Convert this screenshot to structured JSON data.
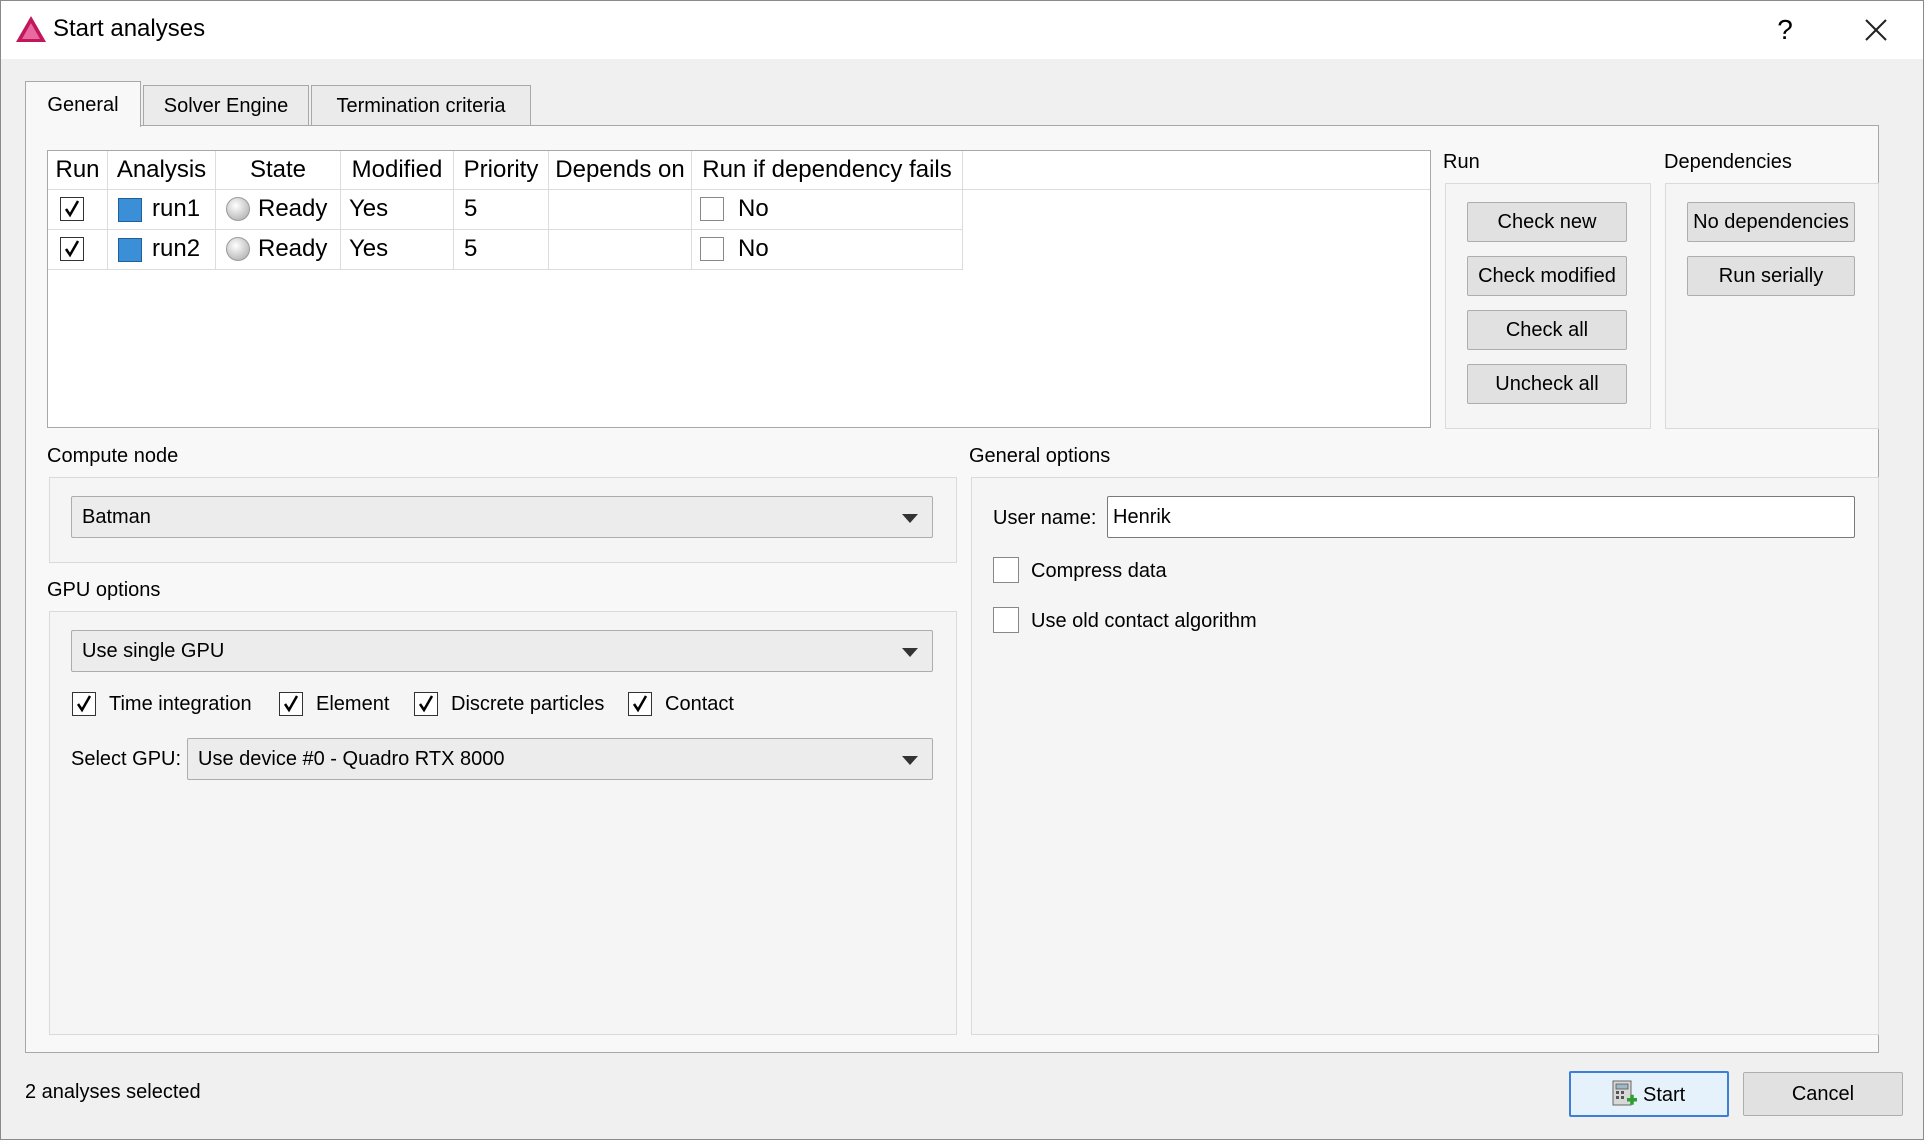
{
  "window": {
    "title": "Start analyses",
    "help_label": "?",
    "icon": "app-triangle-icon"
  },
  "tabs": [
    {
      "label": "General",
      "active": true
    },
    {
      "label": "Solver Engine",
      "active": false
    },
    {
      "label": "Termination criteria",
      "active": false
    }
  ],
  "analyses_table": {
    "columns": [
      "Run",
      "Analysis",
      "State",
      "Modified",
      "Priority",
      "Depends on",
      "Run if dependency fails"
    ],
    "rows": [
      {
        "run": true,
        "analysis": "run1",
        "state": "Ready",
        "modified": "Yes",
        "priority": "5",
        "depends_on": "",
        "run_if_fails": false,
        "run_if_fails_label": "No"
      },
      {
        "run": true,
        "analysis": "run2",
        "state": "Ready",
        "modified": "Yes",
        "priority": "5",
        "depends_on": "",
        "run_if_fails": false,
        "run_if_fails_label": "No"
      }
    ]
  },
  "run_group": {
    "label": "Run",
    "buttons": [
      "Check new",
      "Check modified",
      "Check all",
      "Uncheck all"
    ]
  },
  "dependencies_group": {
    "label": "Dependencies",
    "buttons": [
      "No dependencies",
      "Run serially"
    ]
  },
  "compute_node": {
    "label": "Compute node",
    "value": "Batman"
  },
  "gpu_options": {
    "label": "GPU options",
    "mode": "Use single GPU",
    "checks": [
      {
        "label": "Time integration",
        "checked": true
      },
      {
        "label": "Element",
        "checked": true
      },
      {
        "label": "Discrete particles",
        "checked": true
      },
      {
        "label": "Contact",
        "checked": true
      }
    ],
    "select_gpu_label": "Select GPU:",
    "select_gpu_value": "Use device #0 - Quadro RTX 8000"
  },
  "general_options": {
    "label": "General options",
    "user_name_label": "User name:",
    "user_name_value": "Henrik",
    "checks": [
      {
        "label": "Compress data",
        "checked": false
      },
      {
        "label": "Use old contact algorithm",
        "checked": false
      }
    ]
  },
  "footer": {
    "status": "2 analyses selected",
    "start_label": "Start",
    "cancel_label": "Cancel"
  }
}
